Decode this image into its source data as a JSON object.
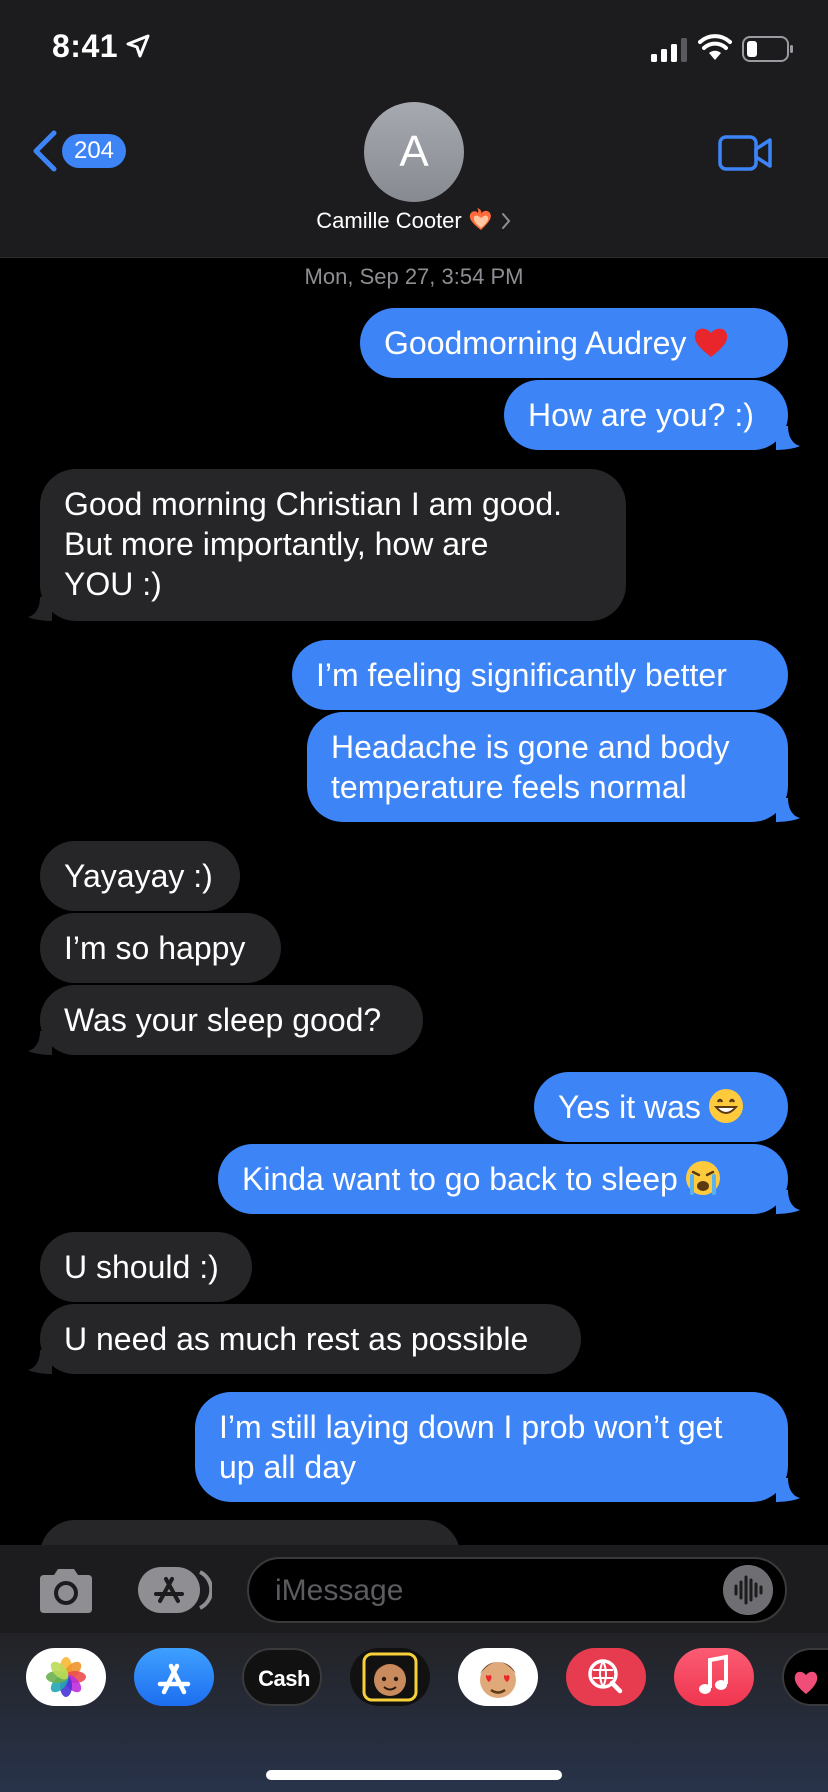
{
  "status_bar": {
    "time": "8:41",
    "icons": [
      "location-arrow-icon",
      "signal-bars-icon",
      "wifi-icon",
      "battery-icon"
    ]
  },
  "header": {
    "back_badge": "204",
    "avatar_initial": "A",
    "contact_name": "Camille Cooter",
    "contact_emoji": "heart-on-fire-icon",
    "video_icon": "video-camera-icon"
  },
  "thread": {
    "timestamp": "Mon, Sep 27, 3:54 PM",
    "messages": [
      {
        "from": "me",
        "text": "Goodmorning Audrey",
        "emoji": "red-heart-icon"
      },
      {
        "from": "me",
        "text": "How are you? :)"
      },
      {
        "from": "them",
        "lines": [
          "Good morning Christian I am good.",
          "But more importantly, how are",
          "YOU :)"
        ]
      },
      {
        "from": "me",
        "text": "I’m feeling significantly better"
      },
      {
        "from": "me",
        "lines": [
          "Headache is gone and body",
          "temperature feels normal"
        ]
      },
      {
        "from": "them",
        "text": "Yayayay :)"
      },
      {
        "from": "them",
        "text": "I’m so happy"
      },
      {
        "from": "them",
        "text": "Was your sleep good?"
      },
      {
        "from": "me",
        "text": "Yes it was",
        "emoji": "grinning-face-icon"
      },
      {
        "from": "me",
        "text": "Kinda want to go back to sleep",
        "emoji": "crying-face-icon"
      },
      {
        "from": "them",
        "text": "U should :)"
      },
      {
        "from": "them",
        "text": "U need as much rest as possible"
      },
      {
        "from": "me",
        "lines": [
          "I’m still laying down I prob won’t get",
          "up all day"
        ]
      }
    ]
  },
  "composer": {
    "placeholder": "iMessage",
    "camera_icon": "camera-icon",
    "apps_icon": "app-store-icon",
    "audio_icon": "audio-waveform-icon"
  },
  "app_drawer": {
    "apps": [
      {
        "name": "Photos",
        "icon": "photos-icon"
      },
      {
        "name": "App Store",
        "icon": "app-store-icon"
      },
      {
        "name": "Cash",
        "label": "Cash",
        "icon": "apple-cash-icon"
      },
      {
        "name": "Memoji Stickers",
        "icon": "memoji-icon"
      },
      {
        "name": "Animoji",
        "icon": "animoji-icon"
      },
      {
        "name": "Images",
        "icon": "image-search-icon"
      },
      {
        "name": "Music",
        "icon": "music-icon"
      },
      {
        "name": "Digital Touch",
        "icon": "digital-touch-icon"
      }
    ]
  },
  "colors": {
    "sent_bubble": "#3d84f7",
    "received_bubble": "#262628",
    "accent": "#3d84f7",
    "header_bg": "#1c1c1e"
  }
}
